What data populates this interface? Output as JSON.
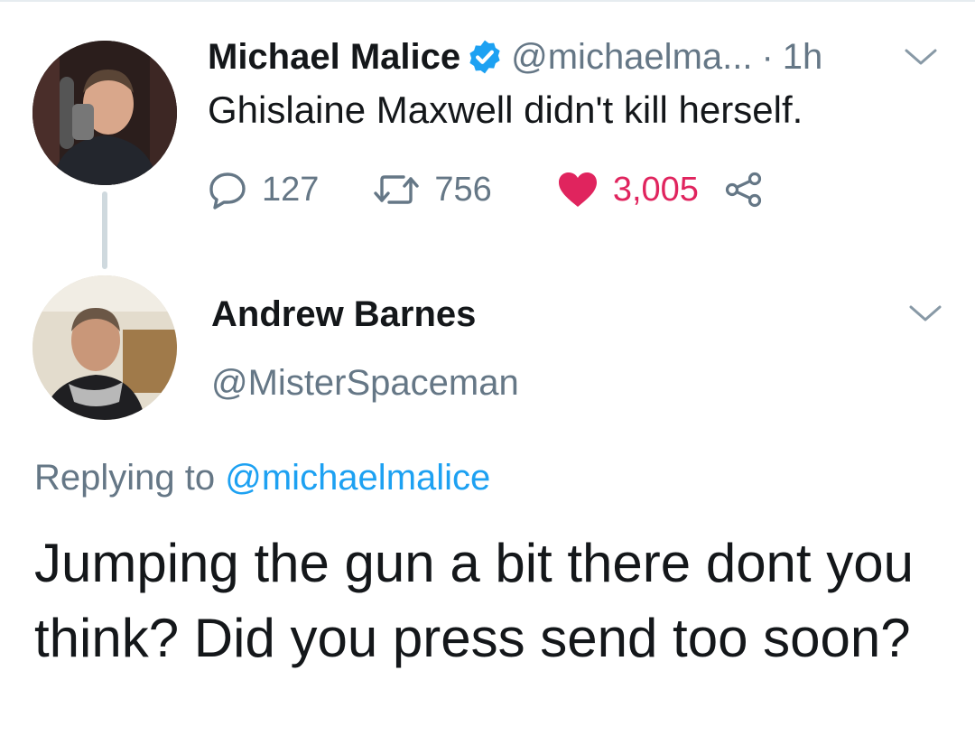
{
  "parent_tweet": {
    "author_name": "Michael Malice",
    "verified": true,
    "handle": "@michaelma...",
    "separator": "·",
    "time": "1h",
    "text": "Ghislaine Maxwell didn't kill herself.",
    "stats": {
      "replies": "127",
      "retweets": "756",
      "likes": "3,005"
    }
  },
  "reply_tweet": {
    "author_name": "Andrew Barnes",
    "handle": "@MisterSpaceman",
    "replying_prefix": "Replying to",
    "replying_to": "@michaelmalice",
    "text": "Jumping the gun a bit there dont you think? Did you press send too soon?"
  },
  "icons": {
    "reply": "reply-icon",
    "retweet": "retweet-icon",
    "like": "heart-icon",
    "share": "share-icon",
    "more": "chevron-down-icon",
    "verified": "verified-badge-icon"
  },
  "colors": {
    "accent": "#1da1f2",
    "like": "#e0245e",
    "secondary_text": "#657786",
    "primary_text": "#14171a"
  }
}
